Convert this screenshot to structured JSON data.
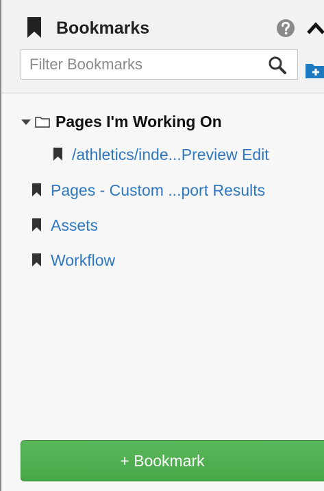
{
  "header": {
    "title": "Bookmarks"
  },
  "filter": {
    "placeholder": "Filter Bookmarks",
    "value": ""
  },
  "folder": {
    "label": "Pages I'm Working On",
    "expanded": true,
    "children": [
      {
        "label": "/athletics/inde...Preview Edit"
      }
    ]
  },
  "bookmarks": [
    {
      "label": "Pages - Custom ...port Results"
    },
    {
      "label": "Assets"
    },
    {
      "label": "Workflow"
    }
  ],
  "footer": {
    "add_label": "+ Bookmark"
  },
  "colors": {
    "link": "#2f78c0",
    "add_button": "#4cae4c",
    "new_folder_icon": "#1e7bc2",
    "icon_dark": "#222222"
  },
  "icons": [
    "bookmark-icon",
    "help-icon",
    "chevron-up-icon",
    "search-icon",
    "new-folder-icon",
    "triangle-down-icon",
    "folder-icon"
  ]
}
